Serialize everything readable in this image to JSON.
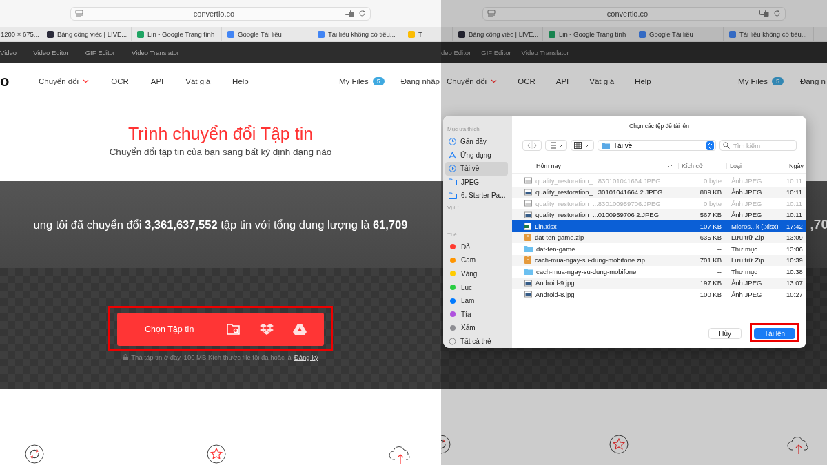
{
  "panels": [
    {
      "browser": {
        "url": "convertio.co",
        "tabs": [
          {
            "title": "1200 × 675...",
            "kind": "plain"
          },
          {
            "title": "Bảng công việc | LIVE...",
            "kind": "app"
          },
          {
            "title": "Lin - Google Trang tính",
            "kind": "sheets"
          },
          {
            "title": "Google Tài liệu",
            "kind": "docs"
          },
          {
            "title": "Tài liệu không có tiêu...",
            "kind": "docs"
          },
          {
            "title": "T",
            "kind": "drive"
          }
        ]
      },
      "top_links": [
        "Video",
        "Video Editor",
        "GIF Editor",
        "Video Translator"
      ],
      "logo": "o",
      "nav": {
        "items": [
          {
            "label": "Chuyển đổi",
            "dropdown": true
          },
          {
            "label": "OCR",
            "dropdown": false
          },
          {
            "label": "API",
            "dropdown": false
          },
          {
            "label": "Vật giá",
            "dropdown": false
          },
          {
            "label": "Help",
            "dropdown": false
          }
        ],
        "my_files": "My Files",
        "files_count": "5",
        "login": "Đăng nhập"
      },
      "hero": {
        "title": "Trình chuyển đổi Tập tin",
        "subtitle": "Chuyển đổi tập tin của bạn sang bất kỳ định dạng nào"
      },
      "stats": "ung tôi đã chuyển đổi **3,361,637,552** tập tin với tổng dung lượng là **61,709**",
      "upload": {
        "label": "Chọn Tập tin",
        "highlighted": true,
        "hint": "Thả tập tin ở đây. 100 MB Kích thước file tối đa hoặc là",
        "signup": "Đăng ký"
      }
    },
    {
      "browser": {
        "url": "convertio.co",
        "tabs": [
          {
            "kind": "plain"
          },
          {
            "title": "Bảng công việc | LIVE...",
            "kind": "app"
          },
          {
            "title": "Lin - Google Trang tính",
            "kind": "sheets"
          },
          {
            "title": "Google Tài liệu",
            "kind": "docs"
          },
          {
            "title": "Tài liệu không có tiêu...",
            "kind": "docs"
          }
        ]
      },
      "top_links": [
        "deo Editor",
        "GIF Editor",
        "Video Translator"
      ],
      "nav": {
        "items": [
          {
            "label": "Chuyển đổi",
            "dropdown": true
          },
          {
            "label": "OCR",
            "dropdown": false
          },
          {
            "label": "API",
            "dropdown": false
          },
          {
            "label": "Vật giá",
            "dropdown": false
          },
          {
            "label": "Help",
            "dropdown": false
          }
        ],
        "my_files": "My Files",
        "files_count": "5",
        "login": "Đăng n"
      },
      "stats": "**,70**",
      "dialog": {
        "title": "Chọn các tệp để tải lên",
        "sidebar": [
          {
            "heading": "Mục ưa thích",
            "items": [
              {
                "label": "Gần đây",
                "kind": "recent",
                "selected": false
              },
              {
                "label": "Ứng dụng",
                "kind": "apps",
                "selected": false
              },
              {
                "label": "Tài về",
                "kind": "downloads",
                "selected": true
              },
              {
                "label": "JPEG",
                "kind": "folder",
                "selected": false
              },
              {
                "label": "6. Starter Pa...",
                "kind": "folder",
                "selected": false
              }
            ]
          },
          {
            "heading": "Vị trí"
          },
          {
            "heading": "Thẻ",
            "items": [
              {
                "label": "Đỏ",
                "kind": "tag",
                "color": "#ff3b30",
                "selected": false
              },
              {
                "label": "Cam",
                "kind": "tag",
                "color": "#ff9500",
                "selected": false
              },
              {
                "label": "Vàng",
                "kind": "tag",
                "color": "#ffcc00",
                "selected": false
              },
              {
                "label": "Lục",
                "kind": "tag",
                "color": "#28cd41",
                "selected": false
              },
              {
                "label": "Lam",
                "kind": "tag",
                "color": "#007aff",
                "selected": false
              },
              {
                "label": "Tía",
                "kind": "tag",
                "color": "#af52de",
                "selected": false
              },
              {
                "label": "Xám",
                "kind": "tag",
                "color": "#8e8e93",
                "selected": false
              },
              {
                "label": "Tất cả thẻ",
                "kind": "alltags",
                "selected": false
              }
            ]
          }
        ],
        "location": "Tài về",
        "search_placeholder": "Tìm kiếm",
        "columns": [
          "Hôm nay",
          "Kích cỡ",
          "Loại",
          "Ngày t"
        ],
        "rows": [
          {
            "name": "quality_restoration_...830101041664.JPEG",
            "size": "0 byte",
            "file_type": "Ảnh JPEG",
            "date": "10:11",
            "kind": "image",
            "selected": false,
            "disabled": true
          },
          {
            "name": "quality_restoration_...30101041664 2.JPEG",
            "size": "889 KB",
            "file_type": "Ảnh JPEG",
            "date": "10:11",
            "kind": "image",
            "selected": false,
            "disabled": false
          },
          {
            "name": "quality_restoration_...830100959706.JPEG",
            "size": "0 byte",
            "file_type": "Ảnh JPEG",
            "date": "10:11",
            "kind": "image",
            "selected": false,
            "disabled": true
          },
          {
            "name": "quality_restoration_...0100959706 2.JPEG",
            "size": "567 KB",
            "file_type": "Ảnh JPEG",
            "date": "10:11",
            "kind": "image",
            "selected": false,
            "disabled": false
          },
          {
            "name": "Lin.xlsx",
            "size": "107 KB",
            "file_type": "Micros...k (.xlsx)",
            "date": "17:42",
            "kind": "sheet",
            "selected": true,
            "disabled": false
          },
          {
            "name": "dat-ten-game.zip",
            "size": "635 KB",
            "file_type": "Lưu trữ Zip",
            "date": "13:09",
            "kind": "zip",
            "selected": false,
            "disabled": false
          },
          {
            "name": "dat-ten-game",
            "size": "--",
            "file_type": "Thư mục",
            "date": "13:06",
            "kind": "folder",
            "selected": false,
            "disabled": false
          },
          {
            "name": "cach-mua-ngay-su-dung-mobifone.zip",
            "size": "701 KB",
            "file_type": "Lưu trữ Zip",
            "date": "10:39",
            "kind": "zip",
            "selected": false,
            "disabled": false
          },
          {
            "name": "cach-mua-ngay-su-dung-mobifone",
            "size": "--",
            "file_type": "Thư mục",
            "date": "10:38",
            "kind": "folder",
            "selected": false,
            "disabled": false
          },
          {
            "name": "Android-9.jpg",
            "size": "197 KB",
            "file_type": "Ảnh JPEG",
            "date": "13:07",
            "kind": "image",
            "selected": false,
            "disabled": false
          },
          {
            "name": "Android-8.jpg",
            "size": "100 KB",
            "file_type": "Ảnh JPEG",
            "date": "10:27",
            "kind": "image",
            "selected": false,
            "disabled": false
          }
        ],
        "buttons": [
          {
            "label": "Hủy",
            "kind": "cancel",
            "highlighted": false
          },
          {
            "label": "Tải lên",
            "kind": "primary",
            "highlighted": true
          }
        ]
      }
    }
  ]
}
